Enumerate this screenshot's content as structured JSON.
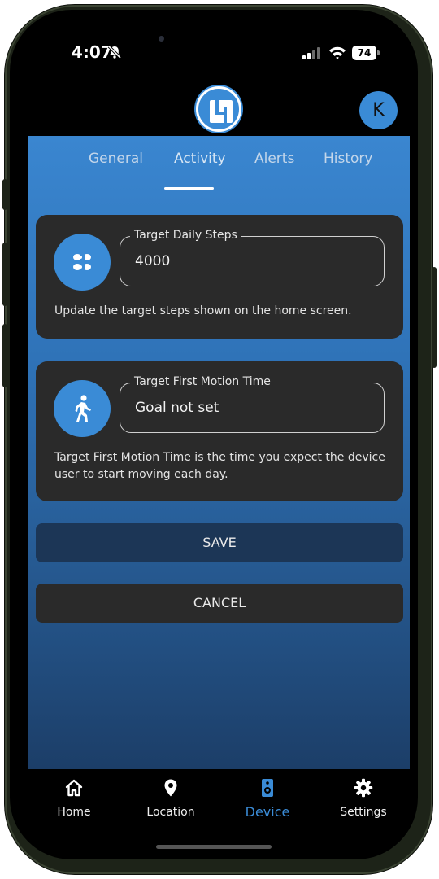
{
  "status_bar": {
    "time": "4:07",
    "battery": "74"
  },
  "header": {
    "avatar_initial": "K"
  },
  "tabs": [
    {
      "label": "General"
    },
    {
      "label": "Activity"
    },
    {
      "label": "Alerts"
    },
    {
      "label": "History"
    }
  ],
  "active_tab": "Activity",
  "cards": {
    "steps": {
      "label": "Target Daily Steps",
      "value": "4000",
      "help": "Update the target steps shown on the home screen."
    },
    "motion": {
      "label": "Target First Motion Time",
      "value": "Goal not set",
      "help": "Target First Motion Time is the time you expect the device user to start moving each day."
    }
  },
  "buttons": {
    "save": "SAVE",
    "cancel": "CANCEL"
  },
  "bottom_nav": [
    {
      "label": "Home",
      "icon": "home-icon"
    },
    {
      "label": "Location",
      "icon": "location-pin-icon"
    },
    {
      "label": "Device",
      "icon": "device-icon"
    },
    {
      "label": "Settings",
      "icon": "gear-icon"
    }
  ],
  "active_nav": "Device",
  "colors": {
    "accent": "#3a8bd6",
    "card": "#2a2a2a",
    "save_button": "#1c3656"
  }
}
